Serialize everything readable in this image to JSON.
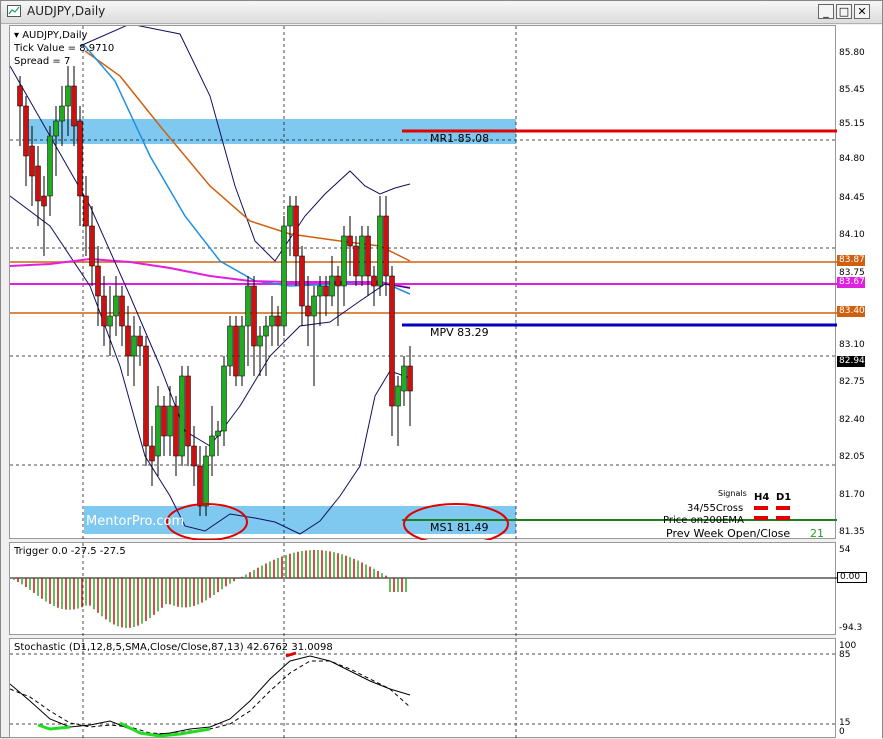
{
  "window": {
    "title": "AUDJPY,Daily",
    "controls": [
      "_",
      "□",
      "✕"
    ]
  },
  "chart": {
    "symbol_label": "AUDJPY,Daily",
    "tick_value": "Tick Value = 8.9710",
    "spread": "Spread = 7",
    "watermark": "MentorPro.com",
    "levels": {
      "mr1": "MR1   85.08",
      "mpv": "MPV   83.29",
      "ms1": "MS1   81.49"
    },
    "price_axis": [
      "85.80",
      "85.45",
      "85.15",
      "84.80",
      "84.45",
      "84.10",
      "83.75",
      "83.10",
      "82.75",
      "82.40",
      "82.05",
      "81.70",
      "81.35"
    ],
    "price_tags": {
      "orange1": "83.87",
      "magenta": "83.67",
      "orange2": "83.40",
      "current": "82.94"
    },
    "signals": {
      "header": "Signals",
      "h4": "H4",
      "d1": "D1",
      "row1": "34/55Cross",
      "row2": "Price on200EMA",
      "row3": "Prev Week Open/Close",
      "row3_value": "21"
    },
    "colors": {
      "bull": "#22aa22",
      "bear": "#cc1111",
      "band": "#7fc8f0",
      "mr1": "#e00000",
      "mpv": "#0000c0",
      "ms1": "#208020",
      "orange": "#d06010",
      "magenta": "#e020e0",
      "ema_blue": "#2090e0"
    }
  },
  "trigger": {
    "label": "Trigger 0.0 -27.5 -27.5",
    "axis": [
      "54",
      "0.00",
      "-94.3"
    ]
  },
  "stochastic": {
    "label": "Stochastic (D1,12,8,5,SMA,Close/Close,87,13) 42.6762 31.0098",
    "axis": [
      "100",
      "85",
      "15",
      "0"
    ]
  }
}
